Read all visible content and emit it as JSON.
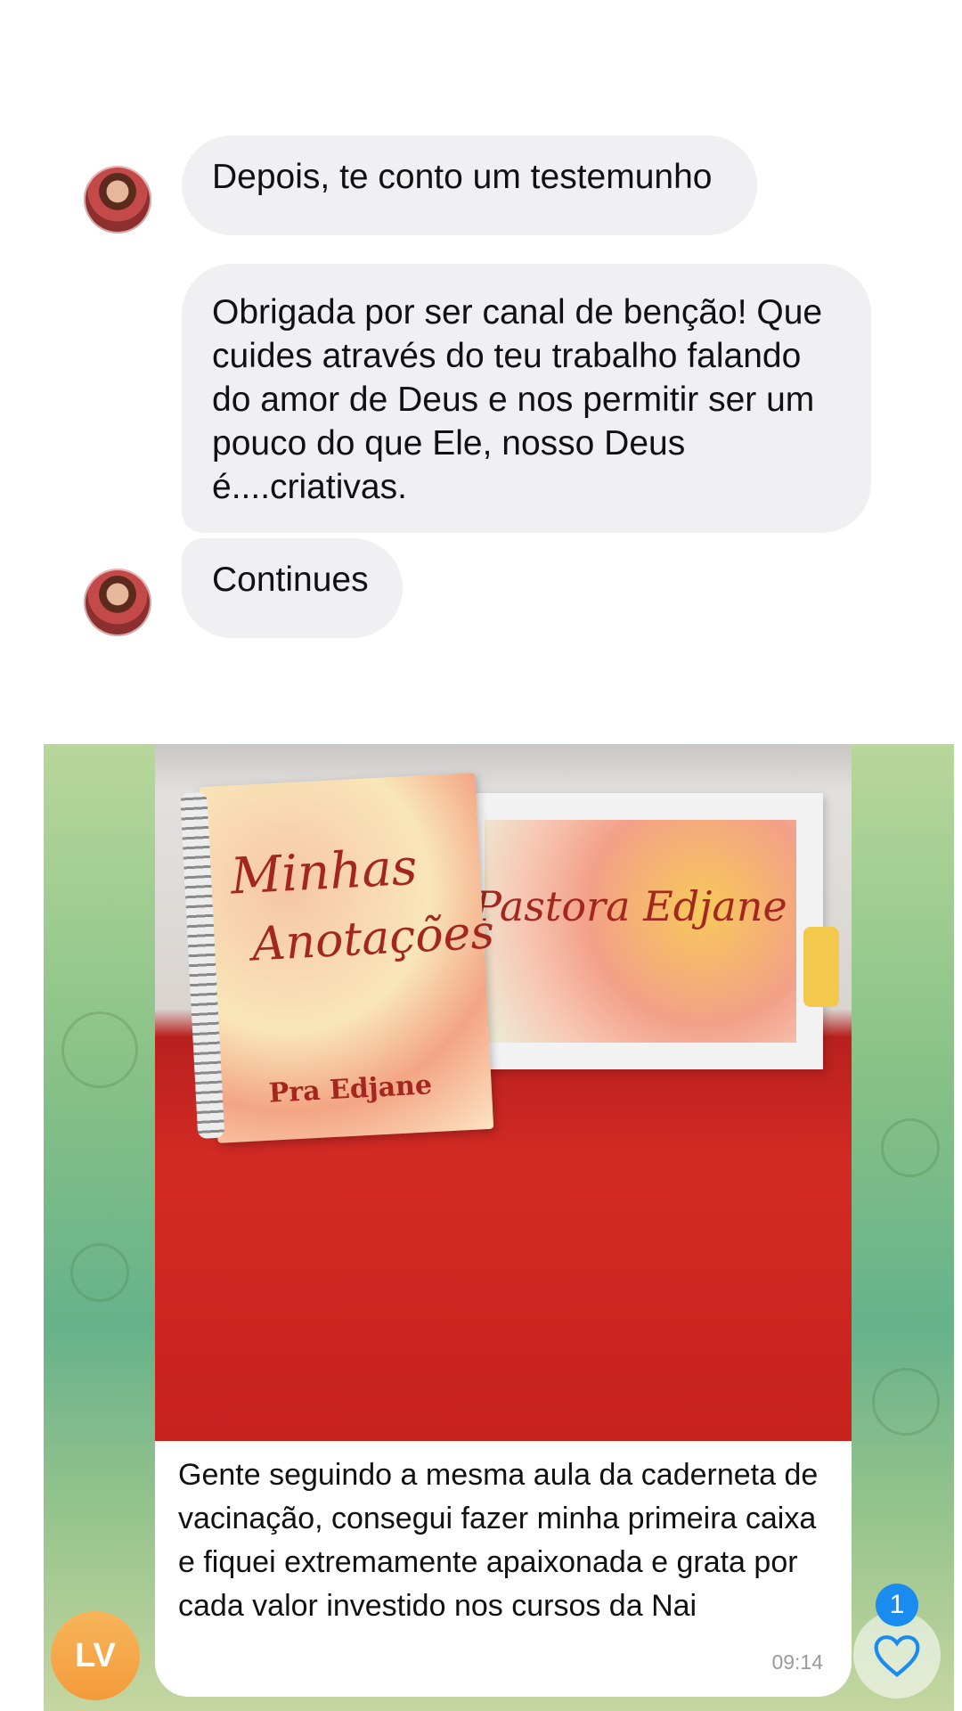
{
  "messages": [
    {
      "text": "Depois, te conto um testemunho"
    },
    {
      "text": "Obrigada por ser canal de benção! Que cuides através do teu trabalho falando do amor de Deus e nos permitir ser um pouco do que Ele, nosso Deus é....criativas."
    },
    {
      "text": "Continues"
    }
  ],
  "shared_post": {
    "photo": {
      "notebook_title_line1": "Minhas",
      "notebook_title_line2": "Anotações",
      "notebook_name": "Pra Edjane",
      "box_name": "Pastora Edjane"
    },
    "caption": "Gente seguindo a mesma aula da caderneta de vacinação, consegui fazer minha primeira caixa e fiquei extremamente apaixonada e grata por cada valor investido nos cursos da Nai",
    "time": "09:14",
    "sender_initials": "LV",
    "reaction_count": "1",
    "reaction_icon": "heart-icon"
  }
}
